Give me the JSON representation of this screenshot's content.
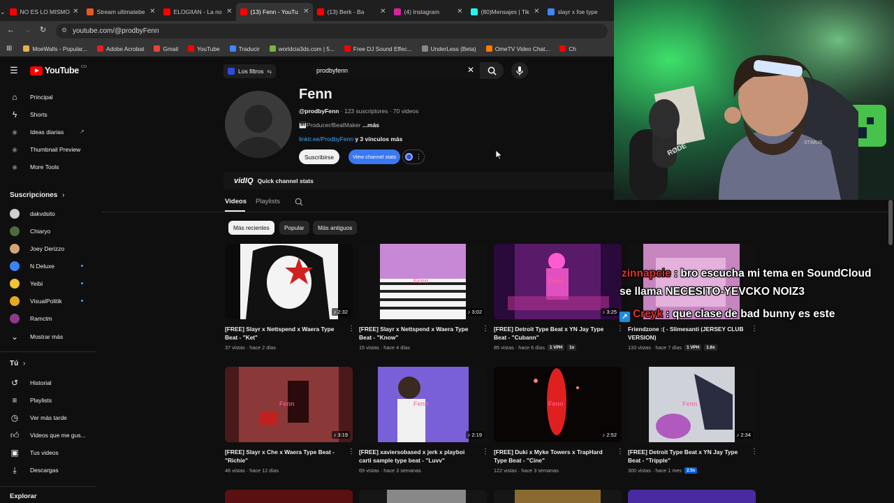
{
  "browser": {
    "tabs": [
      {
        "title": "NO ES LO MISMO",
        "color": "#ff0000"
      },
      {
        "title": "Stream ultimatebe",
        "color": "#e8591e"
      },
      {
        "title": "ELOGIIAN - La no",
        "color": "#ff0000"
      },
      {
        "title": "(13) Fenn - YouTu",
        "color": "#ff0000"
      },
      {
        "title": "(13) Berk - Ba",
        "color": "#ff0000"
      },
      {
        "title": "(4) Instagram",
        "color": "#d6249f"
      },
      {
        "title": "(80)Mensajes | Tik",
        "color": "#25f4ee"
      },
      {
        "title": "slayr x foe type",
        "color": "#4285f4"
      }
    ],
    "url": "youtube.com/@prodbyFenn",
    "bookmarks": [
      {
        "label": "MoeWalls - Popular...",
        "color": "#e8b04a"
      },
      {
        "label": "Adobe Acrobat",
        "color": "#e81e1e"
      },
      {
        "label": "Gmail",
        "color": "#ea4335"
      },
      {
        "label": "YouTube",
        "color": "#ff0000"
      },
      {
        "label": "Traducir",
        "color": "#4285f4"
      },
      {
        "label": "worldcia3ds.com | 5...",
        "color": "#7cb342"
      },
      {
        "label": "Free DJ Sound Effec...",
        "color": "#ff0000"
      },
      {
        "label": "UnderLess (Beta)",
        "color": "#888888"
      },
      {
        "label": "OmeTV Video Chat...",
        "color": "#ff7a00"
      },
      {
        "label": "Ch",
        "color": "#ff0000"
      }
    ]
  },
  "youtube": {
    "logo_text": "YouTube",
    "logo_suffix": "CO",
    "filters_label": "Los filtros",
    "search_value": "prodbyfenn",
    "sidebar": {
      "main": [
        "Principal",
        "Shorts",
        "Ideas diarias",
        "Thumbnail Preview",
        "More Tools"
      ],
      "subs_header": "Suscripciones",
      "subs": [
        {
          "label": "dakvdsito",
          "color": "#cfcfcf",
          "dot": false
        },
        {
          "label": "Chiaryo",
          "color": "#4a6b3e",
          "dot": false
        },
        {
          "label": "Joey Derizzo",
          "color": "#d4a574",
          "dot": false
        },
        {
          "label": "N Deluxe",
          "color": "#3b82f6",
          "dot": true
        },
        {
          "label": "Yeibi",
          "color": "#f2c230",
          "dot": true
        },
        {
          "label": "VisualPolitik",
          "color": "#e5a91f",
          "dot": true
        },
        {
          "label": "Ramctm",
          "color": "#8b3a8b",
          "dot": false
        }
      ],
      "show_more": "Mostrar más",
      "you_header": "Tú",
      "you": [
        "Historial",
        "Playlists",
        "Ver más tarde",
        "Videos que me gus...",
        "Tus videos",
        "Descargas"
      ],
      "explore_header": "Explorar"
    },
    "channel": {
      "name": "Fenn",
      "handle": "@prodbyFenn",
      "stats": "· 123 suscriptores · 70 videos",
      "desc": "🎹Producer/BeatMaker",
      "desc_more": "...más",
      "link": "linktr.ee/ProdbyFenn",
      "link_more": "y 3 vínculos más",
      "subscribe": "Suscribirse",
      "view_stats": "View channel stats",
      "vidiq_logo": "vidIQ",
      "vidiq_label": "Quick channel stats"
    },
    "tabs": [
      "Videos",
      "Playlists"
    ],
    "chips": [
      "Más recientes",
      "Popular",
      "Más antiguos"
    ],
    "videos": [
      {
        "title": "[FREE] Slayr x Nettspend x Waera Type Beat - \"Ket\"",
        "duration": "2:32",
        "meta": "37 vistas · hace 2 días",
        "badges": [],
        "thumb": "#ffffff"
      },
      {
        "title": "[FREE] Slayr x Nettspend x Waera Type Beat - \"Know\"",
        "duration": "3:02",
        "meta": "15 vistas · hace 4 días",
        "badges": [],
        "thumb": "#d9d4e6"
      },
      {
        "title": "[FREE] Detroit Type Beat x YN Jay Type Beat - \"Cubann\"",
        "duration": "3:25",
        "meta": "85 vistas · hace 6 días",
        "badges": [
          "1 VPH",
          "1x"
        ],
        "thumb": "#7a2a8a"
      },
      {
        "title": "Friendzone :( - Slimesanti (JERSEY CLUB VERSION)",
        "duration": "",
        "meta": "133 vistas · hace 7 días",
        "badges": [
          "1 VPH",
          "1.6x"
        ],
        "thumb": "#c07ab8"
      },
      {
        "title": "[FREE] Slayr x Che x Waera Type Beat - \"Richie\"",
        "duration": "3:19",
        "meta": "46 vistas · hace 12 días",
        "badges": [],
        "thumb": "#7a3030"
      },
      {
        "title": "[FREE] xaviersobased x jerk x playboi carti sample type beat - \"Luvv\"",
        "duration": "2:19",
        "meta": "69 vistas · hace 3 semanas",
        "badges": [],
        "thumb": "#6a5ad0"
      },
      {
        "title": "[FREE] Duki x Myke Towers x TrapHard Type Beat - \"Cine\"",
        "duration": "2:52",
        "meta": "122 vistas · hace 3 semanas",
        "badges": [],
        "thumb": "#601818"
      },
      {
        "title": "[FREE] Detroit Type Beat x YN Jay Type Beat - \"Tripple\"",
        "duration": "2:34",
        "meta": "300 vistas · hace 1 mes",
        "badges": [
          "2.5x"
        ],
        "thumb": "#d8d8dc"
      }
    ],
    "thumb_text": "Fenn"
  },
  "overlay": {
    "chat": [
      {
        "user": "zinnapcie",
        "user_color": "#e03030",
        "message": "bro escucha mi tema en SoundCloud"
      },
      {
        "user": "",
        "user_color": "#ffffff",
        "message": "se llama NECESITO-YEVCKO NOIZ3"
      },
      {
        "user": "Creyk",
        "user_color": "#e03030",
        "message": "que clase de bad bunny es este"
      }
    ],
    "mic_brand": "RØDE",
    "poster_text": "STIMUS"
  }
}
